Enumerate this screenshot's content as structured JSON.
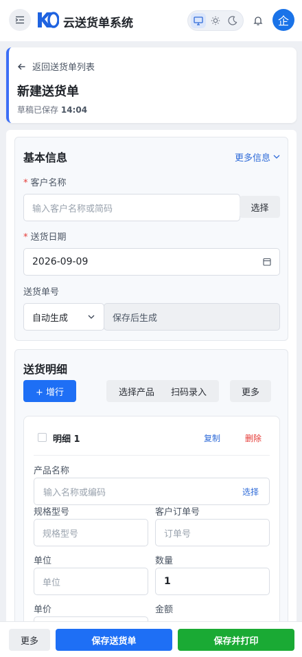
{
  "app": {
    "title": "云送货单系统",
    "avatar_text": "企",
    "theme_options": [
      "monitor-icon",
      "sun-icon",
      "moon-icon"
    ],
    "active_theme": "monitor-icon",
    "colors": {
      "primary": "#1e6ff5",
      "success": "#1aaa34",
      "danger": "#e53935",
      "link": "#2f6bd8"
    }
  },
  "header": {
    "back_label": "返回送货单列表",
    "page_title": "新建送货单",
    "save_status_prefix": "草稿已保存",
    "save_status_time": "14:04"
  },
  "basic_info": {
    "title": "基本信息",
    "more_label": "更多信息",
    "customer": {
      "required_mark": "*",
      "label": "客户名称",
      "placeholder": "输入客户名称或简码",
      "select_label": "选择"
    },
    "date": {
      "required_mark": "*",
      "label": "送货日期",
      "value": "2026-09-09"
    },
    "order_no": {
      "label": "送货单号",
      "mode_value": "自动生成",
      "generated_text": "保存后生成"
    }
  },
  "details": {
    "title": "送货明细",
    "add_row_label": "+ 增行",
    "select_product_label": "选择产品",
    "scan_label": "扫码录入",
    "more_label": "更多",
    "items": [
      {
        "title": "明细 1",
        "copy_label": "复制",
        "delete_label": "删除",
        "product_label": "产品名称",
        "product_placeholder": "输入名称或编码",
        "product_select_label": "选择",
        "spec_label": "规格型号",
        "spec_placeholder": "规格型号",
        "customer_order_label": "客户订单号",
        "customer_order_placeholder": "订单号",
        "unit_label": "单位",
        "unit_placeholder": "单位",
        "qty_label": "数量",
        "qty_value": "1",
        "price_label": "单价",
        "amount_label": "金额"
      }
    ]
  },
  "footer": {
    "more_label": "更多",
    "save_label": "保存送货单",
    "save_print_label": "保存并打印"
  }
}
